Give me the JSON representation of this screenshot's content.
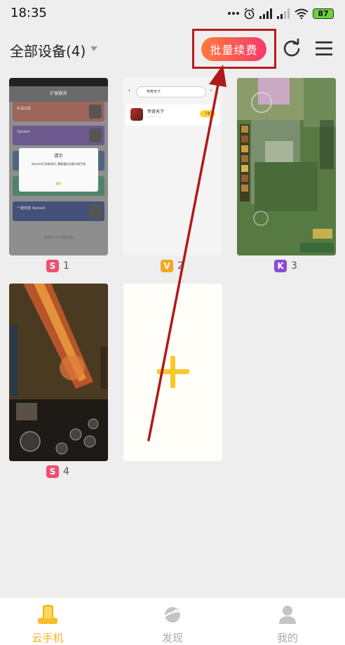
{
  "status_bar": {
    "time": "18:35",
    "battery": "87"
  },
  "header": {
    "title": "全部设备(4)",
    "renew_label": "批量续费"
  },
  "devices": [
    {
      "badge": "S",
      "number": "1",
      "badge_color": "#f0506e"
    },
    {
      "badge": "V",
      "number": "2",
      "badge_color": "#f6a623"
    },
    {
      "badge": "K",
      "number": "3",
      "badge_color": "#8a4bd8"
    },
    {
      "badge": "S",
      "number": "4",
      "badge_color": "#f0506e"
    }
  ],
  "device1_screen": {
    "title": "扩展服务",
    "rows": [
      "私语设置",
      "Xposed",
      "",
      "",
      "一键安装 Xposed"
    ],
    "dialog_title": "提示",
    "dialog_text": "Xposed已安装成功, 需要重启设备才能生效",
    "dialog_button": "重启",
    "bottom_text": "使用方法 问题反馈"
  },
  "device2_screen": {
    "search_text": "传奇天下",
    "app_name": "传奇天下",
    "download_label": "下载"
  },
  "bottom_nav": [
    {
      "label": "云手机",
      "active": true
    },
    {
      "label": "发现",
      "active": false
    },
    {
      "label": "我的",
      "active": false
    }
  ],
  "colors": {
    "accent": "#f6b21a",
    "highlight_box": "#b91c1c"
  }
}
